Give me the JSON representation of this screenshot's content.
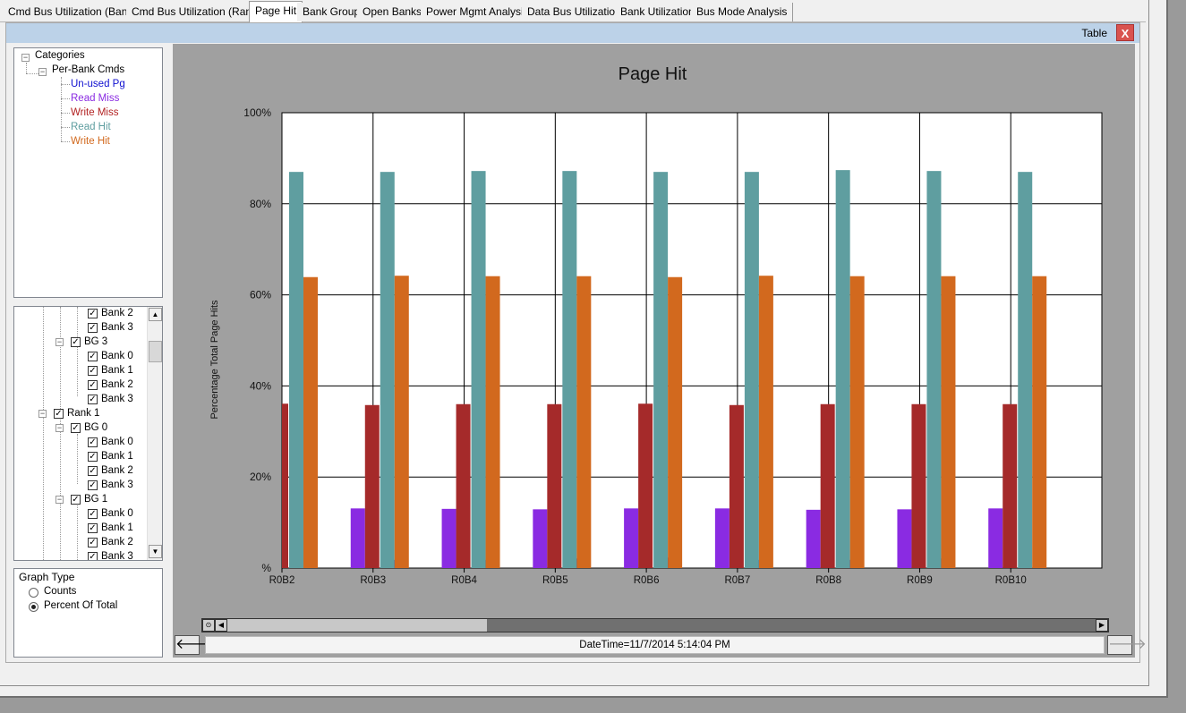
{
  "tabs": [
    {
      "label": "Cmd Bus Utilization (Bank)",
      "active": false
    },
    {
      "label": "Cmd Bus Utilization (Rank)",
      "active": false
    },
    {
      "label": "Page Hit",
      "active": true
    },
    {
      "label": "Bank Group",
      "active": false
    },
    {
      "label": "Open Banks",
      "active": false
    },
    {
      "label": "Power Mgmt Analysis",
      "active": false
    },
    {
      "label": "Data Bus Utilization",
      "active": false
    },
    {
      "label": "Bank Utilization",
      "active": false
    },
    {
      "label": "Bus Mode Analysis",
      "active": false
    }
  ],
  "panel": {
    "table_label": "Table",
    "close_label": "X"
  },
  "categories": {
    "root": "Categories",
    "group": "Per-Bank Cmds",
    "items": [
      {
        "label": "Un-used Pg",
        "color": "#1010d0"
      },
      {
        "label": "Read Miss",
        "color": "#8a2be2"
      },
      {
        "label": "Write Miss",
        "color": "#a0262e"
      },
      {
        "label": "Read Hit",
        "color": "#5f9ea0"
      },
      {
        "label": "Write Hit",
        "color": "#d2691e"
      }
    ]
  },
  "tree": {
    "labels": [
      "Bank 2",
      "Bank 3",
      "BG 3",
      "Bank 0",
      "Bank 1",
      "Bank 2",
      "Bank 3",
      "Rank 1",
      "BG 0",
      "Bank 0",
      "Bank 1",
      "Bank 2",
      "Bank 3",
      "BG 1",
      "Bank 0",
      "Bank 1",
      "Bank 2",
      "Bank 3"
    ]
  },
  "graph_type": {
    "title": "Graph Type",
    "options": [
      {
        "label": "Counts",
        "selected": false
      },
      {
        "label": "Percent Of Total",
        "selected": true
      }
    ]
  },
  "chart_data": {
    "type": "bar",
    "title": "Page Hit",
    "xlabel": "",
    "ylabel": "Percentage Total Page Hits",
    "ylim": [
      0,
      100
    ],
    "yticks": [
      "%",
      "20%",
      "40%",
      "60%",
      "80%",
      "100%"
    ],
    "categories": [
      "R0B2",
      "R0B3",
      "R0B4",
      "R0B5",
      "R0B6",
      "R0B7",
      "R0B8",
      "R0B9",
      "R0B10"
    ],
    "series": [
      {
        "name": "Un-used Pg",
        "color": "#1010e8",
        "values": [
          0.0,
          2.3,
          1.8,
          1.8,
          2.1,
          2.3,
          1.8,
          1.8,
          2.1
        ]
      },
      {
        "name": "Read Miss",
        "color": "#8a2be2",
        "values": [
          0.0,
          13.1,
          13.0,
          12.9,
          13.1,
          13.1,
          12.8,
          12.9,
          13.1
        ]
      },
      {
        "name": "Write Miss",
        "color": "#a52a2a",
        "values": [
          36.1,
          35.8,
          36.0,
          36.0,
          36.1,
          35.8,
          36.0,
          36.0,
          36.0
        ]
      },
      {
        "name": "Read Hit",
        "color": "#5f9ea0",
        "values": [
          87.0,
          87.0,
          87.2,
          87.2,
          87.0,
          87.0,
          87.4,
          87.2,
          87.0
        ]
      },
      {
        "name": "Write Hit",
        "color": "#d2691e",
        "values": [
          63.9,
          64.2,
          64.1,
          64.1,
          63.9,
          64.2,
          64.1,
          64.1,
          64.1
        ]
      }
    ]
  },
  "status": {
    "datetime": "DateTime=11/7/2014 5:14:04 PM"
  }
}
